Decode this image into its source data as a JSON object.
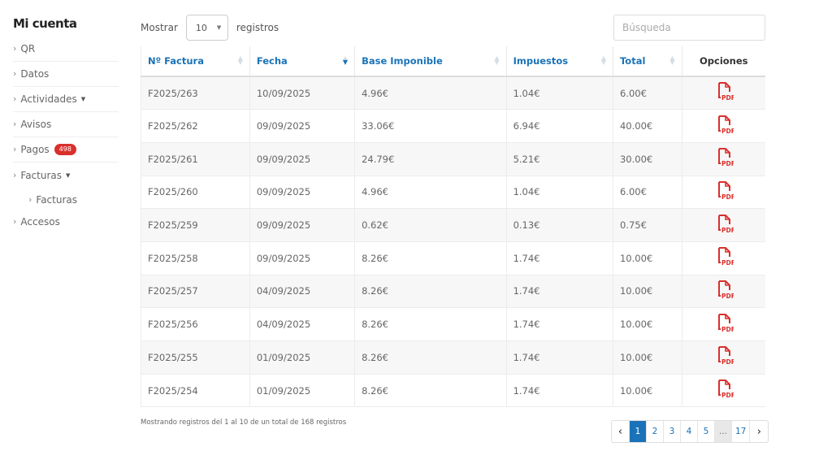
{
  "sidebar": {
    "title": "Mi cuenta",
    "items": [
      {
        "label": "QR"
      },
      {
        "label": "Datos"
      },
      {
        "label": "Actividades"
      },
      {
        "label": "Avisos"
      },
      {
        "label": "Pagos",
        "badge": "498"
      },
      {
        "label": "Facturas"
      },
      {
        "label": "Facturas"
      },
      {
        "label": "Accesos"
      }
    ]
  },
  "controls": {
    "show_label": "Mostrar",
    "page_size": "10",
    "records_label": "registros",
    "search_placeholder": "Búsqueda"
  },
  "table": {
    "headers": [
      "Nº Factura",
      "Fecha",
      "Base Imponible",
      "Impuestos",
      "Total",
      "Opciones"
    ],
    "rows": [
      {
        "factura": "F2025/263",
        "fecha": "10/09/2025",
        "base": "4.96€",
        "impuestos": "1.04€",
        "total": "6.00€"
      },
      {
        "factura": "F2025/262",
        "fecha": "09/09/2025",
        "base": "33.06€",
        "impuestos": "6.94€",
        "total": "40.00€"
      },
      {
        "factura": "F2025/261",
        "fecha": "09/09/2025",
        "base": "24.79€",
        "impuestos": "5.21€",
        "total": "30.00€"
      },
      {
        "factura": "F2025/260",
        "fecha": "09/09/2025",
        "base": "4.96€",
        "impuestos": "1.04€",
        "total": "6.00€"
      },
      {
        "factura": "F2025/259",
        "fecha": "09/09/2025",
        "base": "0.62€",
        "impuestos": "0.13€",
        "total": "0.75€"
      },
      {
        "factura": "F2025/258",
        "fecha": "09/09/2025",
        "base": "8.26€",
        "impuestos": "1.74€",
        "total": "10.00€"
      },
      {
        "factura": "F2025/257",
        "fecha": "04/09/2025",
        "base": "8.26€",
        "impuestos": "1.74€",
        "total": "10.00€"
      },
      {
        "factura": "F2025/256",
        "fecha": "04/09/2025",
        "base": "8.26€",
        "impuestos": "1.74€",
        "total": "10.00€"
      },
      {
        "factura": "F2025/255",
        "fecha": "01/09/2025",
        "base": "8.26€",
        "impuestos": "1.74€",
        "total": "10.00€"
      },
      {
        "factura": "F2025/254",
        "fecha": "01/09/2025",
        "base": "8.26€",
        "impuestos": "1.74€",
        "total": "10.00€"
      }
    ],
    "pdf_icon": "pdf-file-icon"
  },
  "footer": {
    "info": "Mostrando registros del 1 al 10 de un total de 168 registros",
    "pages": [
      "1",
      "2",
      "3",
      "4",
      "5",
      "...",
      "17"
    ],
    "prev": "‹",
    "next": "›"
  },
  "colors": {
    "accent": "#1a73b8",
    "badge": "#d9302c",
    "pdf": "#d9302c"
  }
}
